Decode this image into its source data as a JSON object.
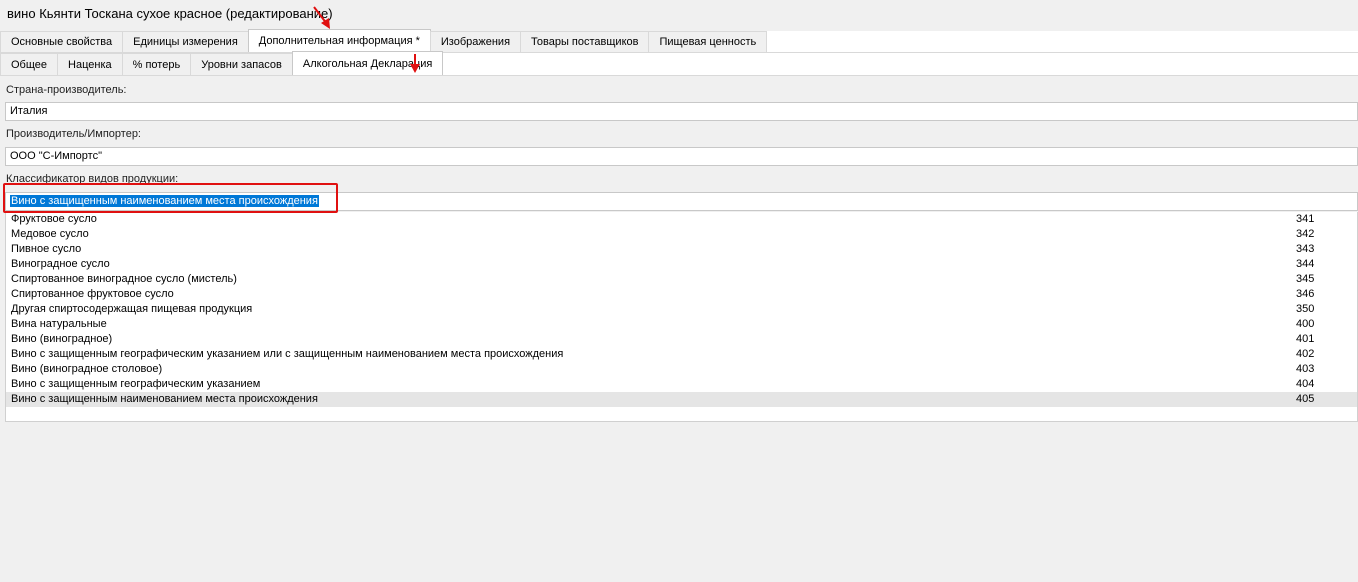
{
  "window": {
    "title": "вино Кьянти Тоскана сухое красное (редактирование)"
  },
  "main_tabs": [
    {
      "label": "Основные свойства"
    },
    {
      "label": "Единицы измерения"
    },
    {
      "label": "Дополнительная информация *"
    },
    {
      "label": "Изображения"
    },
    {
      "label": "Товары поставщиков"
    },
    {
      "label": "Пищевая ценность"
    }
  ],
  "sub_tabs": [
    {
      "label": "Общее"
    },
    {
      "label": "Наценка"
    },
    {
      "label": "% потерь"
    },
    {
      "label": "Уровни запасов"
    },
    {
      "label": "Алкогольная Декларация"
    }
  ],
  "fields": {
    "country_label": "Страна-производитель:",
    "country_value": "Италия",
    "producer_label": "Производитель/Импортер:",
    "producer_value": "ООО \"С-Импортс\"",
    "classifier_label": "Классификатор видов продукции:",
    "classifier_value": "Вино с защищенным наименованием места происхождения"
  },
  "classifier_list": [
    {
      "name": "Фруктовое сусло",
      "code": "341"
    },
    {
      "name": "Медовое сусло",
      "code": "342"
    },
    {
      "name": "Пивное сусло",
      "code": "343"
    },
    {
      "name": "Виноградное сусло",
      "code": "344"
    },
    {
      "name": "Спиртованное виноградное сусло (мистель)",
      "code": "345"
    },
    {
      "name": "Спиртованное фруктовое сусло",
      "code": "346"
    },
    {
      "name": "Другая спиртосодержащая пищевая продукция",
      "code": "350"
    },
    {
      "name": "Вина натуральные",
      "code": "400"
    },
    {
      "name": "Вино (виноградное)",
      "code": "401"
    },
    {
      "name": "Вино с защищенным географическим указанием или с защищенным наименованием места происхождения",
      "code": "402"
    },
    {
      "name": "Вино (виноградное столовое)",
      "code": "403"
    },
    {
      "name": "Вино с защищенным географическим указанием",
      "code": "404"
    },
    {
      "name": "Вино с защищенным наименованием места происхождения",
      "code": "405"
    }
  ],
  "colors": {
    "annotation_red": "#e01010",
    "selection_blue": "#0078d7"
  }
}
